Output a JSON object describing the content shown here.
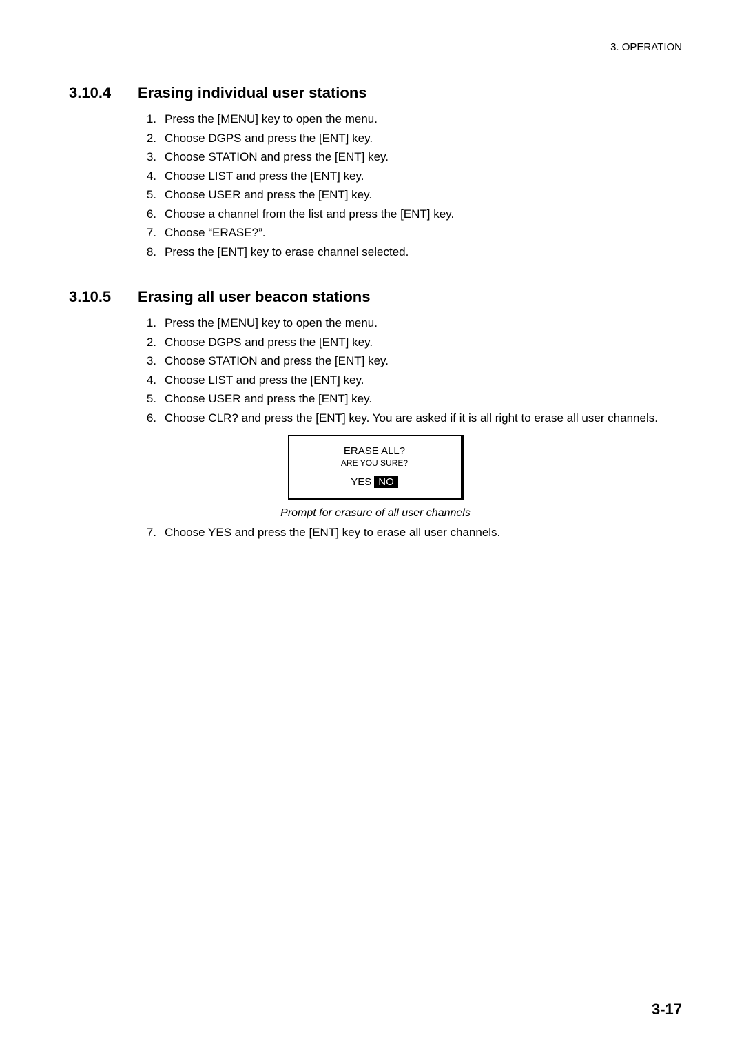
{
  "header": "3. OPERATION",
  "sections": [
    {
      "num": "3.10.4",
      "title": "Erasing individual user stations",
      "items": [
        {
          "n": "1.",
          "t": "Press the [MENU] key to open the menu."
        },
        {
          "n": "2.",
          "t": "Choose DGPS and press the [ENT] key."
        },
        {
          "n": "3.",
          "t": "Choose STATION and press the [ENT] key."
        },
        {
          "n": "4.",
          "t": "Choose LIST and press the [ENT] key."
        },
        {
          "n": "5.",
          "t": "Choose USER and press the [ENT] key."
        },
        {
          "n": "6.",
          "t": "Choose a channel from the list and press the [ENT] key."
        },
        {
          "n": "7.",
          "t": "Choose “ERASE?”."
        },
        {
          "n": "8.",
          "t": "Press the [ENT] key to erase channel selected."
        }
      ]
    },
    {
      "num": "3.10.5",
      "title": "Erasing all user beacon stations",
      "items": [
        {
          "n": "1.",
          "t": "Press the [MENU] key to open the menu."
        },
        {
          "n": "2.",
          "t": "Choose DGPS and press the [ENT] key."
        },
        {
          "n": "3.",
          "t": "Choose STATION and press the [ENT] key."
        },
        {
          "n": "4.",
          "t": "Choose LIST and press the [ENT] key."
        },
        {
          "n": "5.",
          "t": "Choose USER and press the [ENT] key."
        },
        {
          "n": "6.",
          "t": "Choose CLR? and press the [ENT] key. You are asked if it is all right to erase all user channels."
        }
      ]
    }
  ],
  "prompt": {
    "line1": "ERASE ALL?",
    "line2": "ARE YOU SURE?",
    "yes": "YES",
    "no": "NO"
  },
  "caption": "Prompt for erasure of all user channels",
  "post_items": [
    {
      "n": "7.",
      "t": "Choose YES and press the [ENT] key to erase all user channels."
    }
  ],
  "page_num": "3-17"
}
